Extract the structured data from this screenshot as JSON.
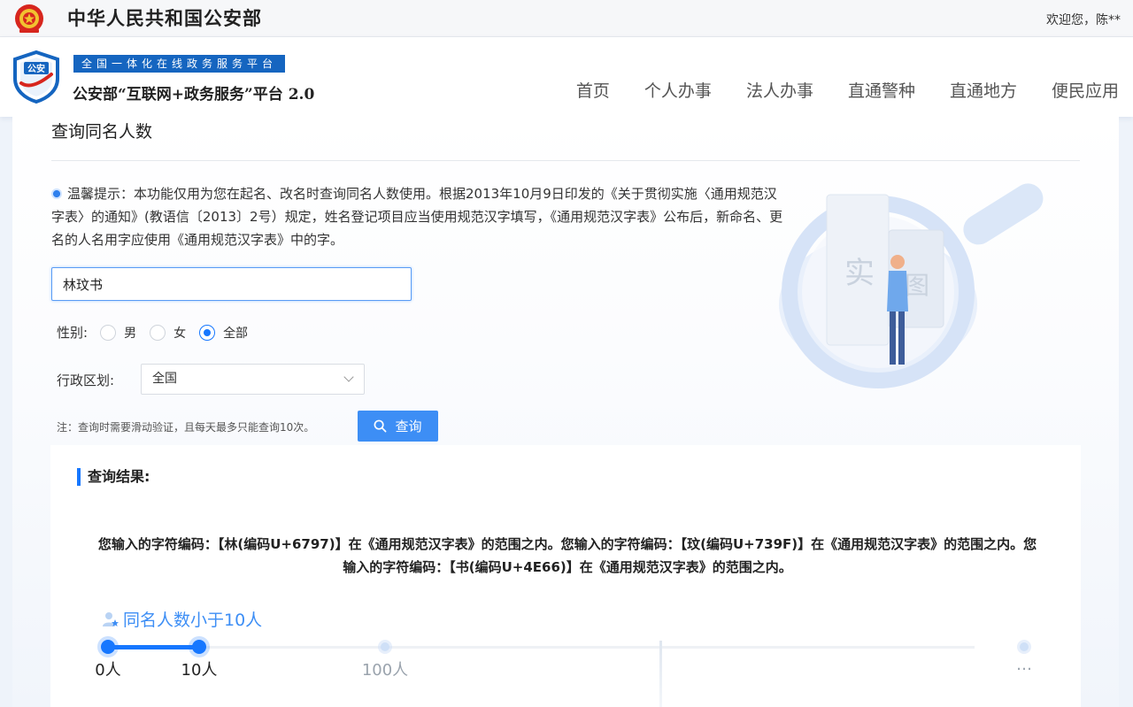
{
  "top_bar": {
    "ministry_title": "中华人民共和国公安部",
    "welcome": "欢迎您，陈**"
  },
  "header": {
    "shield_text": "公安",
    "platform_badge": "全国一体化在线政务服务平台",
    "platform_name": "公安部“互联网+政务服务”平台 2.0",
    "nav": [
      "首页",
      "个人办事",
      "法人办事",
      "直通警种",
      "直通地方",
      "便民应用"
    ]
  },
  "page": {
    "title": "查询同名人数",
    "tip": "温馨提示：本功能仅用为您在起名、改名时查询同名人数使用。根据2013年10月9日印发的《关于贯彻实施〈通用规范汉字表〉的通知》(教语信〔2013〕2号）规定，姓名登记项目应当使用规范汉字填写，《通用规范汉字表》公布后，新命名、更名的人名用字应使用《通用规范汉字表》中的字。"
  },
  "form": {
    "name_value": "林玟书",
    "gender_label": "性别:",
    "gender_options": [
      "男",
      "女",
      "全部"
    ],
    "gender_selected": "全部",
    "region_label": "行政区划:",
    "region_value": "全国",
    "note": "注：查询时需要滑动验证，且每天最多只能查询10次。",
    "search_label": "查询"
  },
  "result": {
    "heading": "查询结果:",
    "text": "您输入的字符编码：【林(编码U+6797)】在《通用规范汉字表》的范围之内。您输入的字符编码：【玟(编码U+739F)】在《通用规范汉字表》的范围之内。您输入的字符编码：【书(编码U+4E66)】在《通用规范汉字表》的范围之内。",
    "count_label": "同名人数小于10人",
    "scale": {
      "ticks": [
        "0人",
        "10人",
        "100人",
        "…"
      ],
      "active_ticks": 2
    }
  },
  "colors": {
    "accent": "#1677ff",
    "badge": "#1565c0",
    "search_button": "#3d8ef5"
  }
}
